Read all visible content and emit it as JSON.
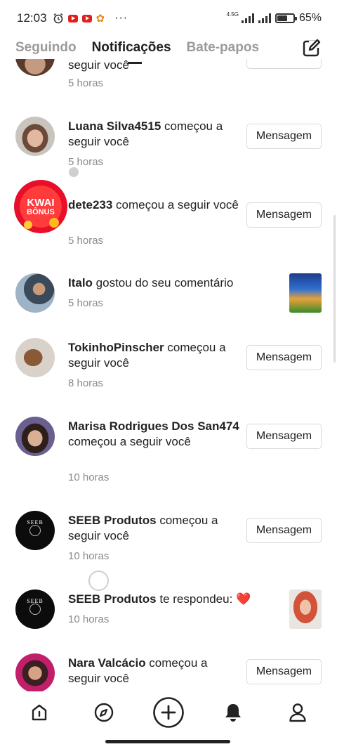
{
  "status_bar": {
    "time": "12:03",
    "network": "4.5G",
    "battery": "65%",
    "battery_level": 0.65,
    "left_icons": [
      "alarm-icon",
      "youtube-icon",
      "youtube-icon",
      "flower-icon"
    ],
    "more": "···"
  },
  "tabs": [
    {
      "label": "Seguindo",
      "active": false
    },
    {
      "label": "Notificações",
      "active": true
    },
    {
      "label": "Bate-papos",
      "active": false
    }
  ],
  "compose_icon": "edit-icon",
  "kwai_badge": [
    "KWAI",
    "BÔNUS"
  ],
  "notifications": [
    {
      "user": "",
      "action": "seguir você",
      "time": "5 horas",
      "button": ""
    },
    {
      "user": "Luana Silva4515",
      "action": " começou a seguir você",
      "time": "5 horas",
      "button": "Mensagem"
    },
    {
      "user": "dete233",
      "action": " começou a seguir você",
      "time": "5 horas",
      "button": "Mensagem"
    },
    {
      "user": "Italo",
      "action": " gostou do seu comentário",
      "time": "5 horas",
      "button": ""
    },
    {
      "user": "TokinhoPinscher",
      "action": " começou a seguir você",
      "time": "8 horas",
      "button": "Mensagem"
    },
    {
      "user": "Marisa Rodrigues Dos San474",
      "action": " começou a seguir você",
      "time": "10 horas",
      "button": "Mensagem"
    },
    {
      "user": "SEEB Produtos",
      "action": " começou a seguir você",
      "time": "10 horas",
      "button": "Mensagem"
    },
    {
      "user": "SEEB Produtos",
      "action": " te respondeu: ",
      "emoji": "❤️",
      "time": "10 horas",
      "button": ""
    },
    {
      "user": "Nara Valcácio",
      "action": " começou a seguir você",
      "time": "",
      "button": "Mensagem"
    }
  ],
  "seeb_logo": "SEEB",
  "bottom_nav": [
    "home-icon",
    "compass-icon",
    "add-icon",
    "bell-icon",
    "profile-icon"
  ]
}
